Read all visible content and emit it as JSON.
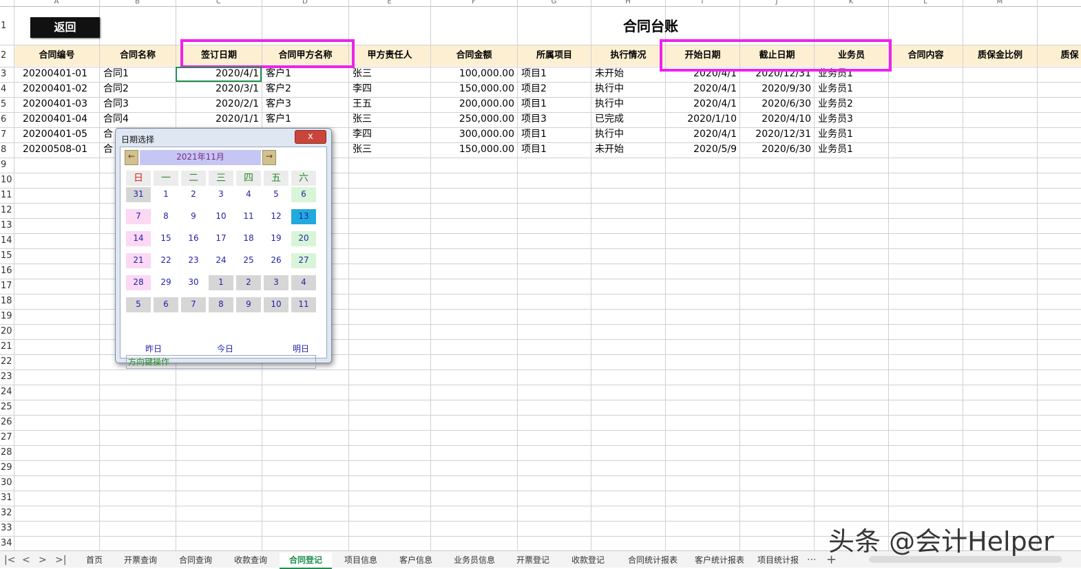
{
  "columns": [
    "A",
    "B",
    "C",
    "D",
    "E",
    "F",
    "G",
    "H",
    "I",
    "J",
    "K",
    "L",
    "M",
    ""
  ],
  "row_numbers": [
    "1",
    "2",
    "3",
    "4",
    "5",
    "6",
    "7",
    "8",
    "9",
    "10",
    "11",
    "12",
    "13",
    "14",
    "15",
    "16",
    "17",
    "18",
    "19",
    "20",
    "21",
    "22",
    "23",
    "24",
    "25",
    "26",
    "27",
    "28",
    "29",
    "30",
    "31",
    "32",
    "33",
    "34"
  ],
  "back_label": "返回",
  "title": "合同台账",
  "headers": [
    "合同编号",
    "合同名称",
    "签订日期",
    "合同甲方名称",
    "甲方责任人",
    "合同金额",
    "所属项目",
    "执行情况",
    "开始日期",
    "截止日期",
    "业务员",
    "合同内容",
    "质保金比例",
    "质保"
  ],
  "rows": [
    [
      "20200401-01",
      "合同1",
      "2020/4/1",
      "客户1",
      "张三",
      "100,000.00",
      "项目1",
      "未开始",
      "2020/4/1",
      "2020/12/31",
      "业务员1"
    ],
    [
      "20200401-02",
      "合同2",
      "2020/3/1",
      "客户2",
      "李四",
      "150,000.00",
      "项目2",
      "执行中",
      "2020/4/1",
      "2020/9/30",
      "业务员1"
    ],
    [
      "20200401-03",
      "合同3",
      "2020/2/1",
      "客户3",
      "王五",
      "200,000.00",
      "项目1",
      "执行中",
      "2020/4/1",
      "2020/6/30",
      "业务员2"
    ],
    [
      "20200401-04",
      "合同4",
      "2020/1/1",
      "客户1",
      "张三",
      "250,000.00",
      "项目3",
      "已完成",
      "2020/1/10",
      "2020/4/10",
      "业务员3"
    ],
    [
      "20200401-05",
      "合",
      "",
      "",
      "李四",
      "300,000.00",
      "项目1",
      "执行中",
      "2020/4/1",
      "2020/12/31",
      "业务员1"
    ],
    [
      "20200508-01",
      "合",
      "",
      "",
      "张三",
      "150,000.00",
      "项目1",
      "未开始",
      "2020/5/9",
      "2020/6/30",
      "业务员1"
    ]
  ],
  "dialog": {
    "title": "日期选择",
    "close": "x",
    "month": "2021年11月",
    "prev": "←",
    "next": "→",
    "weekdays": [
      "日",
      "一",
      "二",
      "三",
      "四",
      "五",
      "六"
    ],
    "weeks": [
      [
        "31",
        "1",
        "2",
        "3",
        "4",
        "5",
        "6"
      ],
      [
        "7",
        "8",
        "9",
        "10",
        "11",
        "12",
        "13"
      ],
      [
        "14",
        "15",
        "16",
        "17",
        "18",
        "19",
        "20"
      ],
      [
        "21",
        "22",
        "23",
        "24",
        "25",
        "26",
        "27"
      ],
      [
        "28",
        "29",
        "30",
        "1",
        "2",
        "3",
        "4"
      ],
      [
        "5",
        "6",
        "7",
        "8",
        "9",
        "10",
        "11"
      ]
    ],
    "selected": "13",
    "yesterday": "昨日",
    "today": "今日",
    "tomorrow": "明日",
    "hint": "方向键操作"
  },
  "tabs": [
    "首页",
    "开票查询",
    "合同查询",
    "收款查询",
    "合同登记",
    "项目信息",
    "客户信息",
    "业务员信息",
    "开票登记",
    "收款登记",
    "合同统计报表",
    "客户统计报表",
    "项目统计报"
  ],
  "active_tab": "合同登记",
  "tab_more": "···",
  "tab_add": "+",
  "watermark": "头条 @会计Helper",
  "colors": {
    "highlight": "#ee22ee",
    "header_bg": "#fdf0d2",
    "active_tab": "#1f8f4e"
  }
}
